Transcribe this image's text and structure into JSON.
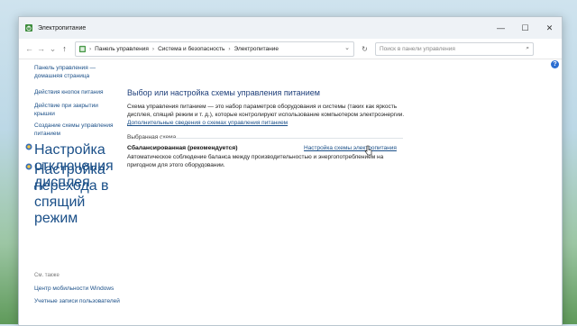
{
  "window": {
    "title": "Электропитание",
    "minimize_icon": "minimize-icon",
    "maximize_icon": "maximize-icon",
    "close_icon": "close-icon"
  },
  "navbar": {
    "back_icon": "arrow-left-icon",
    "forward_icon": "arrow-right-icon",
    "recent_icon": "chevron-down-icon",
    "up_icon": "arrow-up-icon",
    "breadcrumbs": [
      "Панель управления",
      "Система и безопасность",
      "Электропитание"
    ],
    "refresh_icon": "refresh-icon",
    "search_placeholder": "Поиск в панели управления",
    "search_icon": "search-icon"
  },
  "sidebar": {
    "home_label": "Панель управления — домашняя страница",
    "items": [
      "Действия кнопок питания",
      "Действие при закрытии крышки",
      "Создание схемы управления питанием",
      "Настройка отключения дисплея",
      "Настройка перехода в спящий режим"
    ],
    "see_also_label": "См. также",
    "see_also_items": [
      "Центр мобильности Windows",
      "Учетные записи пользователей"
    ]
  },
  "main": {
    "heading": "Выбор или настройка схемы управления питанием",
    "description": "Схема управления питанием — это набор параметров оборудования и системы (таких как яркость дисплея, спящий режим и т. д.), которые контролируют использование компьютером электроэнергии.",
    "more_info_link": "Дополнительные сведения о схемах управления питанием",
    "selected_plan_label": "Выбранная схема",
    "plan_name": "Сбалансированная (рекомендуется)",
    "plan_settings_link": "Настройка схемы электропитания",
    "plan_description": "Автоматическое соблюдение баланса между производительностью и энергопотреблением на пригодном для этого оборудовании."
  },
  "colors": {
    "link": "#1a4f88",
    "heading": "#1e3f7a",
    "help": "#2b6ed1"
  }
}
